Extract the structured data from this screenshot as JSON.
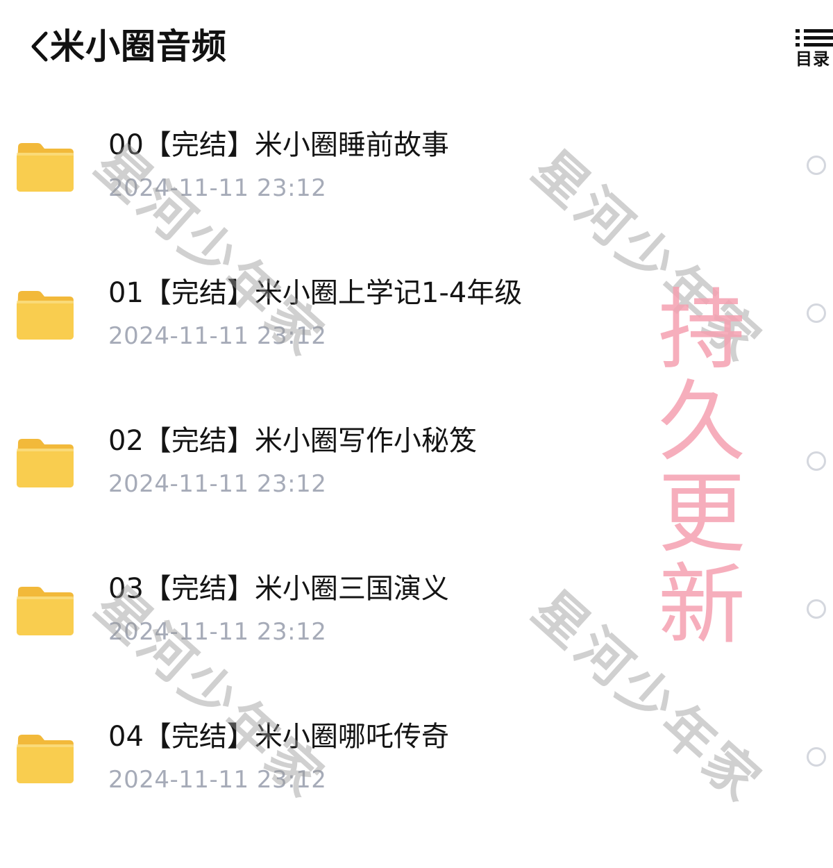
{
  "header": {
    "title": "米小圈音频",
    "back_icon": "chevron-left-icon",
    "toc_label": "目录",
    "toc_icon": "list-icon"
  },
  "files": [
    {
      "name": "00【完结】米小圈睡前故事",
      "time": "2024-11-11 23:12",
      "icon": "folder-icon"
    },
    {
      "name": "01【完结】米小圈上学记1-4年级",
      "time": "2024-11-11 23:12",
      "icon": "folder-icon"
    },
    {
      "name": "02【完结】米小圈写作小秘笈",
      "time": "2024-11-11 23:12",
      "icon": "folder-icon"
    },
    {
      "name": "03【完结】米小圈三国演义",
      "time": "2024-11-11 23:12",
      "icon": "folder-icon"
    },
    {
      "name": "04【完结】米小圈哪吒传奇",
      "time": "2024-11-11 23:12",
      "icon": "folder-icon"
    }
  ],
  "watermark": {
    "text": "星河少年家",
    "stamp": "持久更新"
  },
  "colors": {
    "folder": "#f9cd4f",
    "timestamp": "#a6abb8",
    "stamp": "#f4a0b0"
  }
}
